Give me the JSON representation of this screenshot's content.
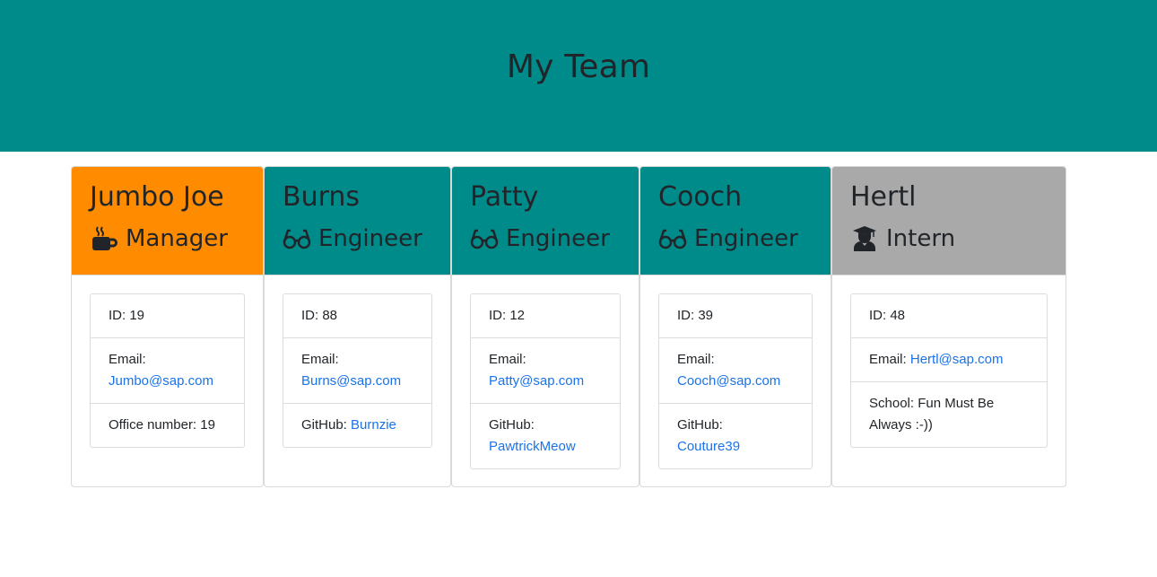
{
  "page": {
    "title": "My Team"
  },
  "colors": {
    "header_bg": "#008b8b",
    "manager_bg": "#ff8c00",
    "engineer_bg": "#008b8b",
    "intern_bg": "#a9a9a9",
    "link": "#1a73e8"
  },
  "cards": [
    {
      "name": "Jumbo Joe",
      "role": "Manager",
      "icon": "mug-icon",
      "id_text": "ID: 19",
      "email_label": "Email:",
      "email": "Jumbo@sap.com",
      "extra_label": "Office number: 19",
      "extra_value": ""
    },
    {
      "name": "Burns",
      "role": "Engineer",
      "icon": "glasses-icon",
      "id_text": "ID: 88",
      "email_label": "Email:",
      "email": "Burns@sap.com",
      "extra_label": "GitHub:",
      "extra_value": "Burnzie"
    },
    {
      "name": "Patty",
      "role": "Engineer",
      "icon": "glasses-icon",
      "id_text": "ID: 12",
      "email_label": "Email:",
      "email": "Patty@sap.com",
      "extra_label": "GitHub:",
      "extra_value": "PawtrickMeow"
    },
    {
      "name": "Cooch",
      "role": "Engineer",
      "icon": "glasses-icon",
      "id_text": "ID: 39",
      "email_label": "Email:",
      "email": "Cooch@sap.com",
      "extra_label": "GitHub:",
      "extra_value": "Couture39"
    },
    {
      "name": "Hertl",
      "role": "Intern",
      "icon": "graduate-icon",
      "id_text": "ID: 48",
      "email_label": "Email:",
      "email": "Hertl@sap.com",
      "extra_label": "School: Fun Must Be Always :-))",
      "extra_value": ""
    }
  ]
}
